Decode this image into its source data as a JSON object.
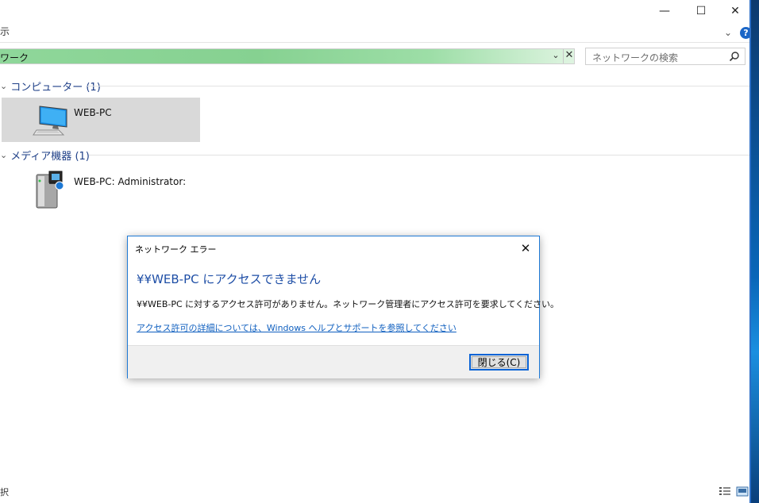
{
  "window": {
    "caption_minimize": "—",
    "caption_maximize": "☐",
    "caption_close": "✕",
    "ribbon_fragment": "示",
    "ribbon_chevron": "⌄",
    "help_glyph": "?"
  },
  "address_bar": {
    "path": "ワーク",
    "dropdown_glyph": "⌄",
    "clear_glyph": "✕"
  },
  "search": {
    "placeholder": "ネットワークの検索"
  },
  "groups": [
    {
      "header": "コンピューター (1)",
      "chevron": "⌄",
      "items": [
        {
          "label": "WEB-PC",
          "icon": "computer-monitor-icon"
        }
      ]
    },
    {
      "header": "メディア機器 (1)",
      "chevron": "⌄",
      "items": [
        {
          "label": "WEB-PC: Administrator:",
          "icon": "media-server-icon"
        }
      ]
    }
  ],
  "status_bar": {
    "left_fragment": "択"
  },
  "dialog": {
    "title": "ネットワーク エラー",
    "close_glyph": "✕",
    "heading": "¥¥WEB-PC にアクセスできません",
    "message": "¥¥WEB-PC に対するアクセス許可がありません。ネットワーク管理者にアクセス許可を要求してください。",
    "link": "アクセス許可の詳細については、Windows ヘルプとサポートを参照してください",
    "close_button": "閉じる(C)"
  },
  "colors": {
    "accent_blue": "#1e4ea6",
    "link_blue": "#0f5fbf",
    "address_green": "#8fd79a",
    "dialog_border": "#1f7ad6"
  }
}
